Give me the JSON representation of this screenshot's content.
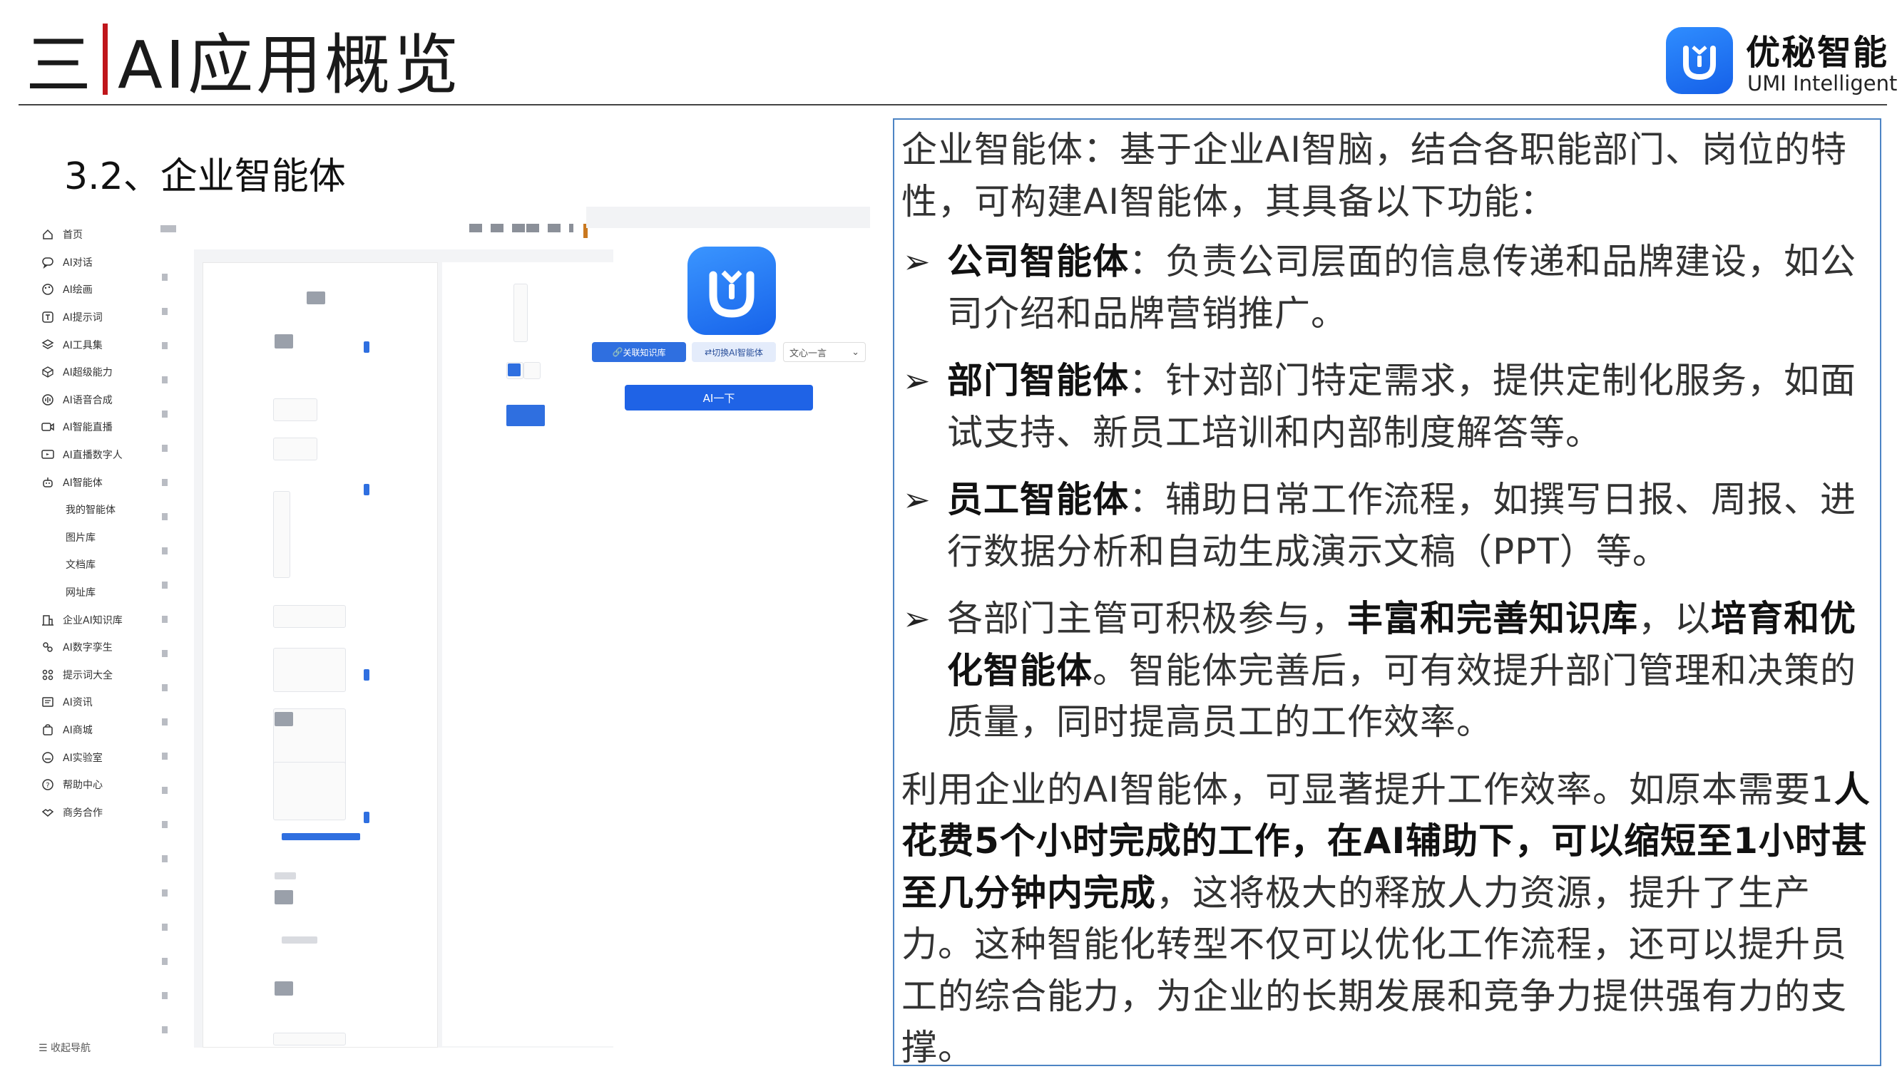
{
  "header": {
    "section_number": "三",
    "title": "AI应用概览",
    "brand_name": "优秘智能",
    "brand_sub": "UMI Intelligent",
    "accent_color": "#c0161b",
    "brand_color": "#1f63e6"
  },
  "section_title": "3.2、企业智能体",
  "app": {
    "nav": [
      {
        "label": "首页",
        "icon": "home-icon"
      },
      {
        "label": "AI对话",
        "icon": "chat-icon"
      },
      {
        "label": "AI绘画",
        "icon": "palette-icon"
      },
      {
        "label": "AI提示词",
        "icon": "prompt-icon"
      },
      {
        "label": "AI工具集",
        "icon": "layers-icon"
      },
      {
        "label": "AI超级能力",
        "icon": "cube-icon"
      },
      {
        "label": "AI语音合成",
        "icon": "voice-icon"
      },
      {
        "label": "AI智能直播",
        "icon": "live-icon"
      },
      {
        "label": "AI直播数字人",
        "icon": "screen-icon"
      },
      {
        "label": "AI智能体",
        "icon": "robot-icon"
      }
    ],
    "nav_sub": [
      "我的智能体",
      "图片库",
      "文档库",
      "网址库"
    ],
    "nav_more": [
      {
        "label": "企业AI知识库",
        "icon": "building-icon"
      },
      {
        "label": "AI数字孪生",
        "icon": "twin-icon"
      },
      {
        "label": "提示词大全",
        "icon": "grid-icon"
      },
      {
        "label": "AI资讯",
        "icon": "news-icon"
      },
      {
        "label": "AI商城",
        "icon": "shop-icon"
      },
      {
        "label": "AI实验室",
        "icon": "lab-icon"
      },
      {
        "label": "帮助中心",
        "icon": "help-icon"
      },
      {
        "label": "商务合作",
        "icon": "handshake-icon"
      }
    ],
    "collapse_label": "收起导航",
    "preview": {
      "kb_button": "关联知识库",
      "switch_button": "切换AI智能体",
      "model_select": "文心一言",
      "ai_button": "AI一下"
    }
  },
  "content": {
    "intro": "企业智能体：基于企业AI智脑，结合各职能部门、岗位的特性，可构建AI智能体，其具备以下功能：",
    "bullets": [
      {
        "bold": "公司智能体",
        "text": "：负责公司层面的信息传递和品牌建设，如公司介绍和品牌营销推广。"
      },
      {
        "bold": "部门智能体",
        "text": "：针对部门特定需求，提供定制化服务，如面试支持、新员工培训和内部制度解答等。"
      },
      {
        "bold": "员工智能体",
        "text": "：辅助日常工作流程，如撰写日报、周报、进行数据分析和自动生成演示文稿（PPT）等。"
      }
    ],
    "bullet4": {
      "part1": "各部门主管可积极参与，",
      "bold1": "丰富和完善知识库",
      "part2": "，以",
      "bold2": "培育和优化智能体",
      "part3": "。智能体完善后，可有效提升部门管理和决策的质量，同时提高员工的工作效率。"
    },
    "closing": {
      "part1": "利用企业的AI智能体，可显著提升工作效率。如原本需要1",
      "bold1": "人花费5个小时完成的工作，在AI辅助下，可以缩短至1小时甚至几分钟内完成",
      "part2": "，这将极大的释放人力资源，提升了生产力。这种智能化转型不仅可以优化工作流程，还可以提升员工的综合能力，为企业的长期发展和竞争力提供强有力的支撑。"
    }
  }
}
